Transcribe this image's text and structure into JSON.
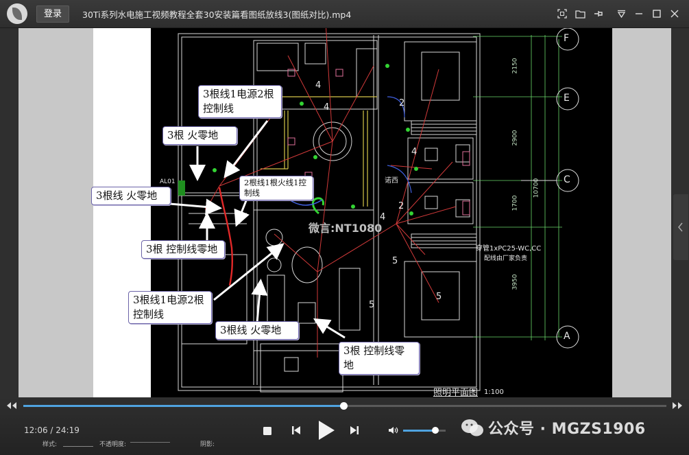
{
  "window": {
    "title": "30Ti系列水电施工视频教程全套30安装篇看图纸放线3(图纸对比).mp4",
    "login_label": "登录"
  },
  "callouts": [
    {
      "id": "c1",
      "text": "3根线1电源2根控制线"
    },
    {
      "id": "c2",
      "text": "3根 火零地"
    },
    {
      "id": "c3",
      "text": "2根线1根火线1控制线"
    },
    {
      "id": "c4",
      "text": "3根线 火零地"
    },
    {
      "id": "c5",
      "text": "3根 控制线零地"
    },
    {
      "id": "c6",
      "text": "3根线1电源2根控制线"
    },
    {
      "id": "c7",
      "text": "3根线 火零地"
    },
    {
      "id": "c8",
      "text": "3根 控制线零地"
    }
  ],
  "drawing": {
    "axis_labels": [
      "F",
      "E",
      "C",
      "A"
    ],
    "dimensions": [
      "2150",
      "2900",
      "1700",
      "3950",
      "10700"
    ],
    "room_numbers": [
      "4",
      "4",
      "2",
      "4",
      "2",
      "4",
      "5",
      "5",
      "5"
    ],
    "panel_label": "AL01",
    "ring_label": "诺西",
    "big_label": "微言:NT1080",
    "pipe_note": "穿管1xPC25-WC,CC",
    "pipe_note_2": "配线由厂家负责",
    "plan_title": "照明平面图",
    "scale": "1:100"
  },
  "player": {
    "time_current": "12:06",
    "time_total": "24:19",
    "progress": 0.498,
    "volume": 0.75,
    "toolbar_style_label": "样式:",
    "toolbar_opacity_label": "不透明度:",
    "toolbar_shadow_label": "阴影:"
  },
  "watermark": "公众号 · MGZS1906",
  "icons": [
    "logo-icon",
    "screenshot-icon",
    "folder-icon",
    "pin-icon",
    "mini-mode-icon",
    "minimize-icon",
    "maximize-icon",
    "close-icon",
    "prev-frame-icon",
    "next-frame-icon",
    "stop-icon",
    "previous-icon",
    "play-icon",
    "next-icon",
    "volume-icon",
    "wechat-icon"
  ]
}
